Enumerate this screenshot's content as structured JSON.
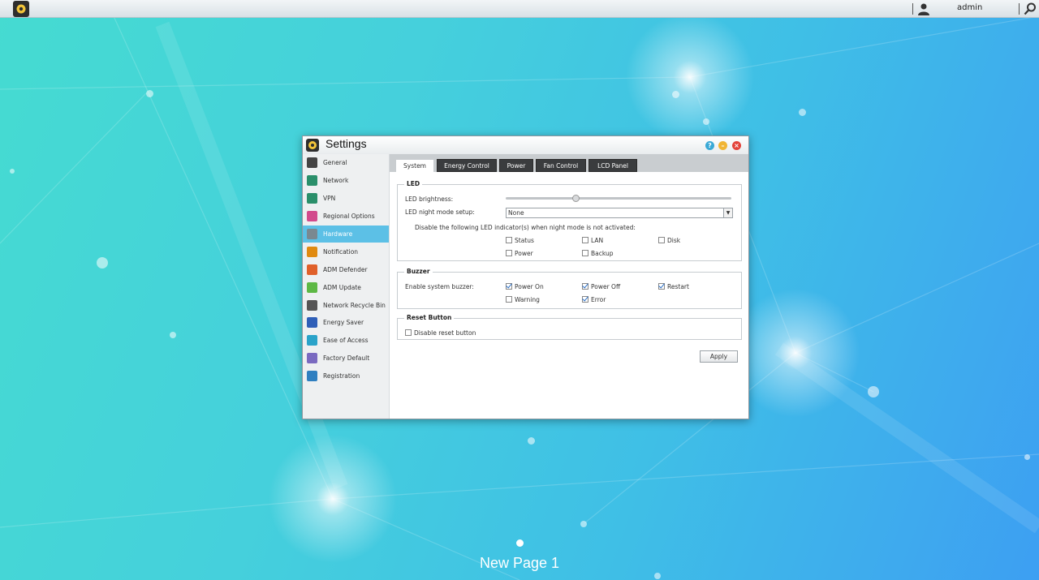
{
  "topbar": {
    "username": "admin"
  },
  "window": {
    "title": "Settings"
  },
  "sidebar": {
    "items": [
      {
        "label": "General",
        "icon": "server-icon",
        "color": "#444444"
      },
      {
        "label": "Network",
        "icon": "globe-icon",
        "color": "#2a8f6a"
      },
      {
        "label": "VPN",
        "icon": "vpn-icon",
        "color": "#2a8f6a"
      },
      {
        "label": "Regional Options",
        "icon": "regional-icon",
        "color": "#d24a8c"
      },
      {
        "label": "Hardware",
        "icon": "hardware-icon",
        "color": "#7a8890"
      },
      {
        "label": "Notification",
        "icon": "alert-icon",
        "color": "#e08a10"
      },
      {
        "label": "ADM Defender",
        "icon": "firewall-icon",
        "color": "#e0602a"
      },
      {
        "label": "ADM Update",
        "icon": "update-icon",
        "color": "#5db845"
      },
      {
        "label": "Network Recycle Bin",
        "icon": "trash-icon",
        "color": "#555555"
      },
      {
        "label": "Energy Saver",
        "icon": "energy-icon",
        "color": "#2f5fb8"
      },
      {
        "label": "Ease of Access",
        "icon": "cloud-icon",
        "color": "#2aa3c9"
      },
      {
        "label": "Factory Default",
        "icon": "undo-icon",
        "color": "#7a6ac0"
      },
      {
        "label": "Registration",
        "icon": "registration-icon",
        "color": "#2f7fc0"
      }
    ],
    "active_index": 4
  },
  "tabs": [
    {
      "label": "System"
    },
    {
      "label": "Energy Control"
    },
    {
      "label": "Power"
    },
    {
      "label": "Fan Control"
    },
    {
      "label": "LCD Panel"
    }
  ],
  "led": {
    "group_title": "LED",
    "brightness_label": "LED brightness:",
    "brightness_value": 0.31,
    "night_mode_label": "LED night mode setup:",
    "night_mode_value": "None",
    "disable_text": "Disable the following LED indicator(s) when night mode is not activated:",
    "indicators": [
      {
        "label": "Status",
        "checked": false
      },
      {
        "label": "LAN",
        "checked": false
      },
      {
        "label": "Disk",
        "checked": false
      },
      {
        "label": "Power",
        "checked": false
      },
      {
        "label": "Backup",
        "checked": false
      }
    ]
  },
  "buzzer": {
    "group_title": "Buzzer",
    "enable_label": "Enable system buzzer:",
    "options": [
      {
        "label": "Power On",
        "checked": true
      },
      {
        "label": "Power Off",
        "checked": true
      },
      {
        "label": "Restart",
        "checked": true
      },
      {
        "label": "Warning",
        "checked": false
      },
      {
        "label": "Error",
        "checked": true
      }
    ]
  },
  "reset": {
    "group_title": "Reset Button",
    "disable_label": "Disable reset button",
    "disable_checked": false
  },
  "apply_label": "Apply",
  "desktop": {
    "page_label": "New Page 1"
  }
}
